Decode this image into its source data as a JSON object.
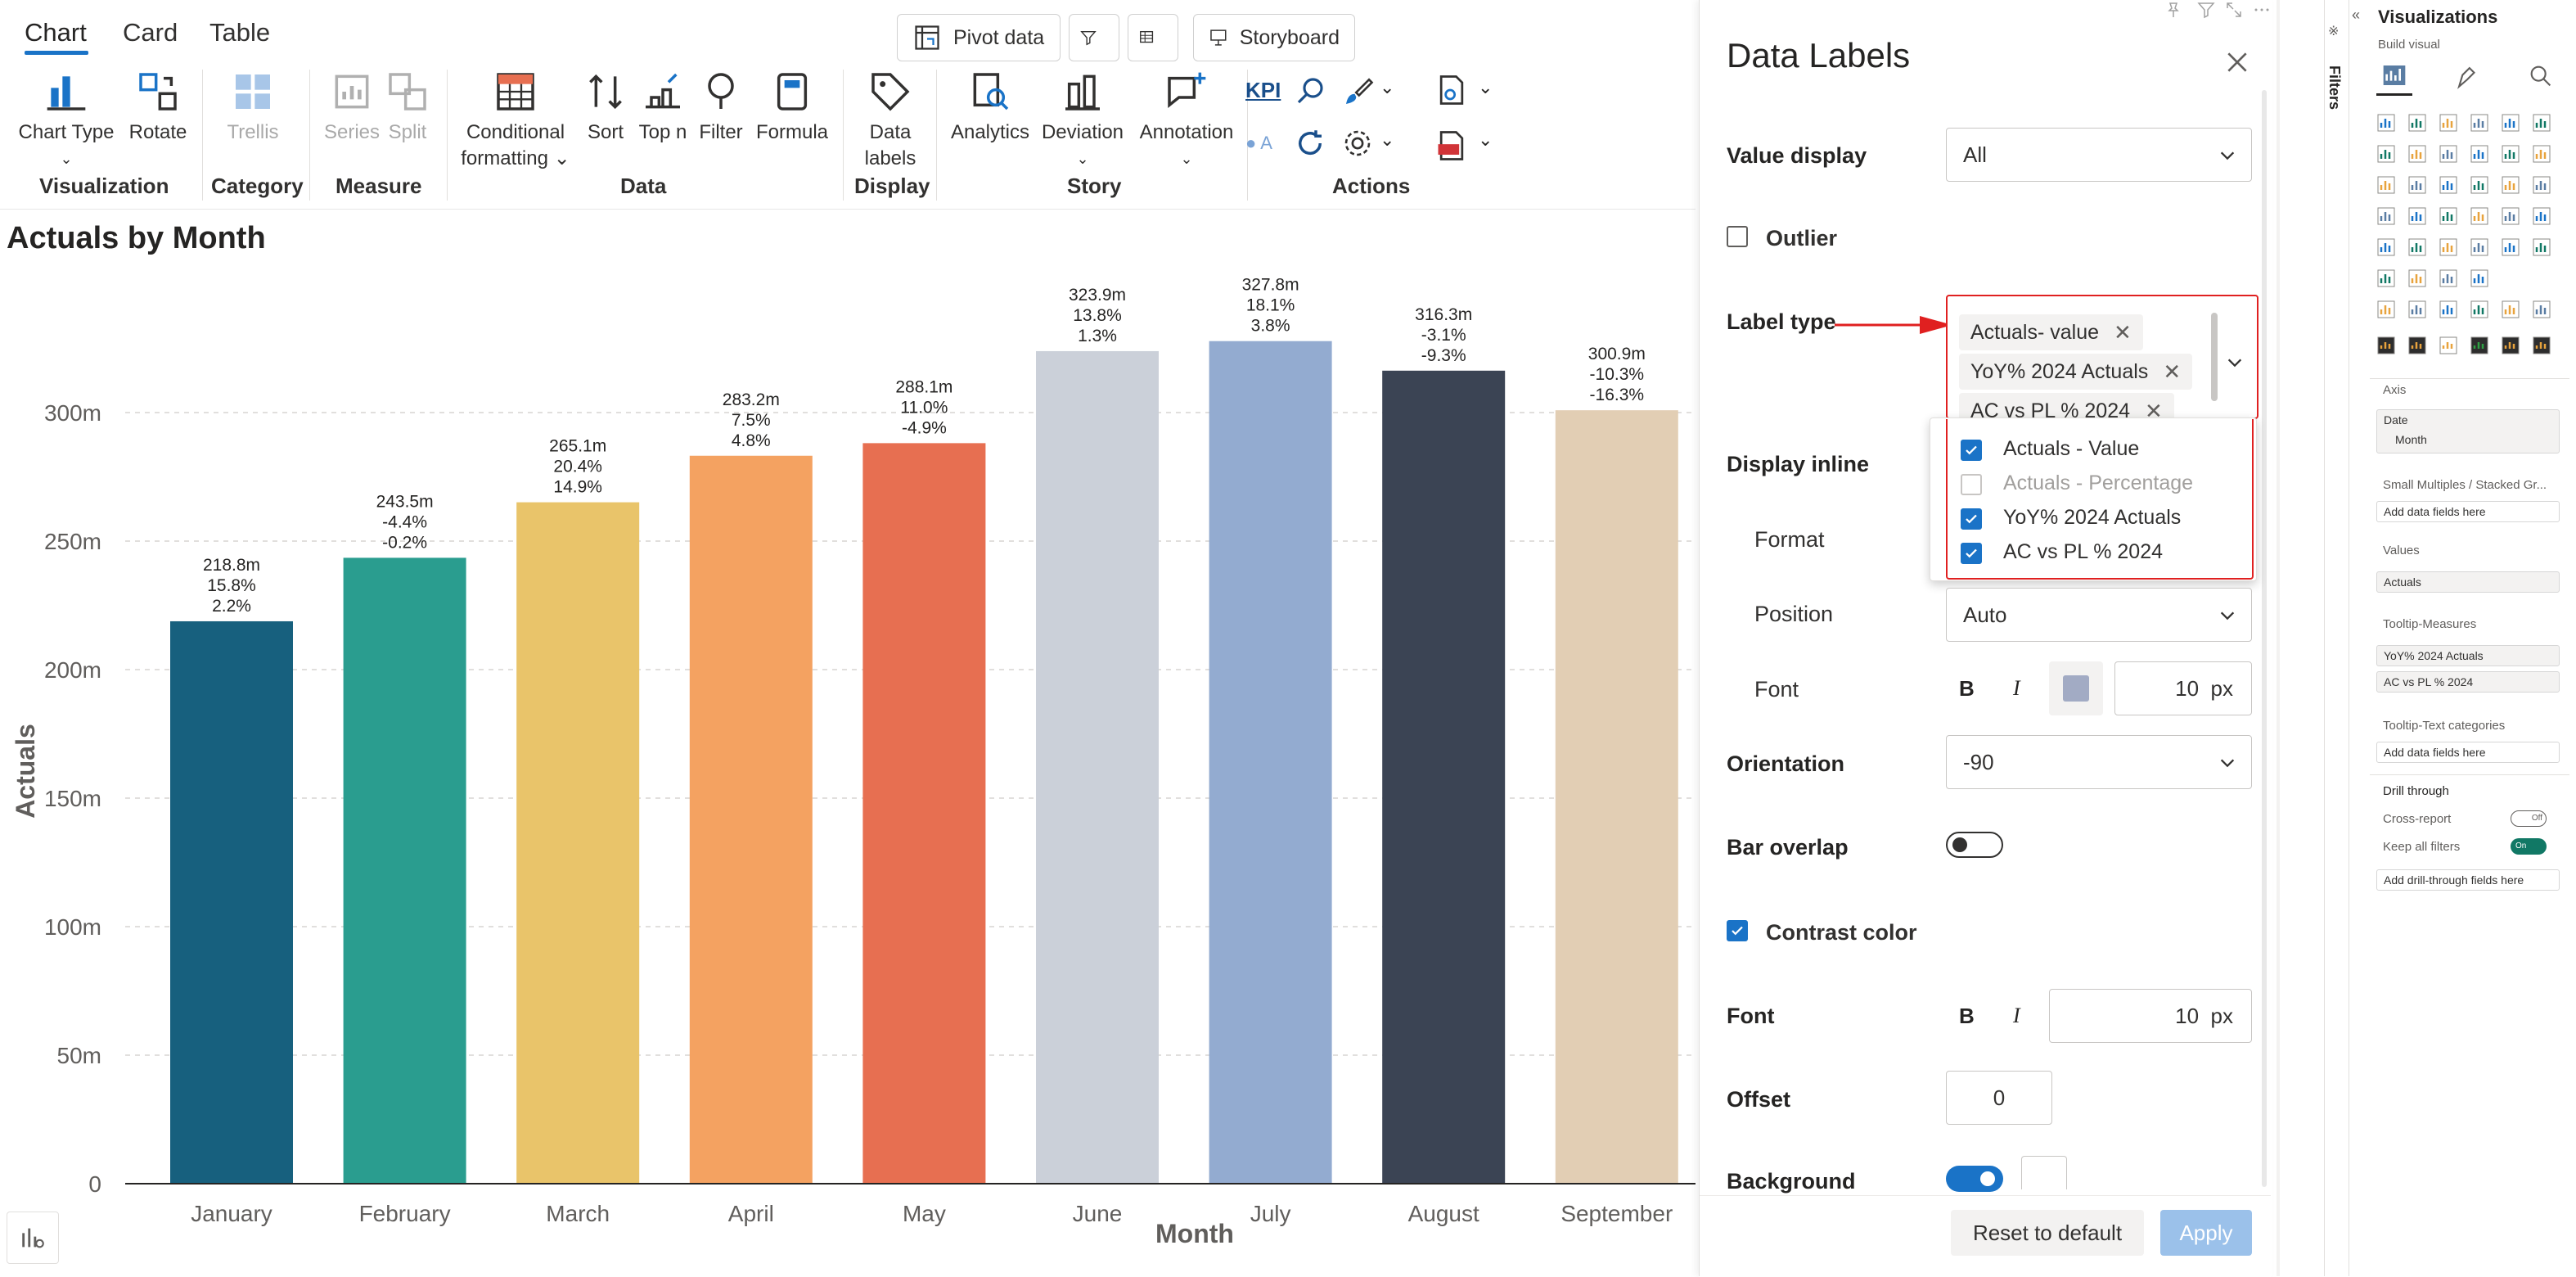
{
  "ribbon": {
    "tabs": [
      "Chart",
      "Card",
      "Table"
    ],
    "top_buttons": {
      "pivot": "Pivot data",
      "storyboard": "Storyboard"
    },
    "buttons": {
      "chart_type": "Chart Type",
      "rotate": "Rotate",
      "trellis": "Trellis",
      "series": "Series",
      "split": "Split",
      "conditional1": "Conditional",
      "conditional2": "formatting",
      "sort": "Sort",
      "topn": "Top n",
      "filter": "Filter",
      "formula": "Formula",
      "data_labels1": "Data",
      "data_labels2": "labels",
      "analytics": "Analytics",
      "deviation": "Deviation",
      "annotation": "Annotation",
      "kpi": "KPI",
      "a_label": "A"
    },
    "groups": [
      "Visualization",
      "Category",
      "Measure",
      "Data",
      "Display",
      "Story",
      "Actions"
    ]
  },
  "chart_data": {
    "type": "bar",
    "title": "Actuals by Month",
    "xlabel": "Month",
    "ylabel": "Actuals",
    "ylim": [
      0,
      350
    ],
    "yticks": [
      "0",
      "50m",
      "100m",
      "150m",
      "200m",
      "250m",
      "300m"
    ],
    "ytick_values": [
      0,
      50,
      100,
      150,
      200,
      250,
      300
    ],
    "categories": [
      "January",
      "February",
      "March",
      "April",
      "May",
      "June",
      "July",
      "August",
      "September"
    ],
    "values": [
      218.8,
      243.5,
      265.1,
      283.2,
      288.1,
      323.9,
      327.8,
      316.3,
      300.9
    ],
    "labels": [
      [
        "218.8m",
        "15.8%",
        "2.2%"
      ],
      [
        "243.5m",
        "-4.4%",
        "-0.2%"
      ],
      [
        "265.1m",
        "20.4%",
        "14.9%"
      ],
      [
        "283.2m",
        "7.5%",
        "4.8%"
      ],
      [
        "288.1m",
        "11.0%",
        "-4.9%"
      ],
      [
        "323.9m",
        "13.8%",
        "1.3%"
      ],
      [
        "327.8m",
        "18.1%",
        "3.8%"
      ],
      [
        "316.3m",
        "-3.1%",
        "-9.3%"
      ],
      [
        "300.9m",
        "-10.3%",
        "-16.3%"
      ]
    ],
    "colors": [
      "#17607e",
      "#2a9d8f",
      "#e9c46a",
      "#f4a261",
      "#e76f51",
      "#cbd0d9",
      "#93abd0",
      "#3b4454",
      "#e2ceb4"
    ]
  },
  "panel": {
    "title": "Data Labels",
    "value_display_label": "Value display",
    "value_display": "All",
    "outlier": "Outlier",
    "label_type": "Label type",
    "chips": [
      "Actuals- value",
      "YoY% 2024 Actuals",
      "AC vs PL % 2024"
    ],
    "dropdown": [
      "Actuals - Value",
      "Actuals - Percentage",
      "YoY% 2024 Actuals",
      "AC vs PL % 2024"
    ],
    "display_inline": "Display inline",
    "format": "Format",
    "position": "Position",
    "position_value": "Auto",
    "font": "Font",
    "font_size": "10",
    "px": "px",
    "bold": "B",
    "italic": "I",
    "orientation": "Orientation",
    "orientation_value": "-90",
    "bar_overlap": "Bar overlap",
    "contrast_color": "Contrast color",
    "font2": "Font",
    "font2_size": "10",
    "offset": "Offset",
    "offset_value": "0",
    "background": "Background",
    "reset": "Reset to default",
    "apply": "Apply"
  },
  "viz": {
    "title": "Visualizations",
    "build": "Build visual",
    "filters": "Filters",
    "axis": "Axis",
    "axis_fields": [
      "Date",
      "Month"
    ],
    "small_multiples": "Small Multiples / Stacked Gr...",
    "add_data": "Add data fields here",
    "values": "Values",
    "values_field": "Actuals",
    "tooltip_measures": "Tooltip-Measures",
    "tooltip_fields": [
      "YoY% 2024 Actuals",
      "AC vs PL % 2024"
    ],
    "tooltip_text": "Tooltip-Text categories",
    "add_data2": "Add data fields here",
    "drill": "Drill through",
    "cross": "Cross-report",
    "cross_state": "Off",
    "keep": "Keep all filters",
    "keep_state": "On",
    "add_drill": "Add drill-through fields here"
  }
}
